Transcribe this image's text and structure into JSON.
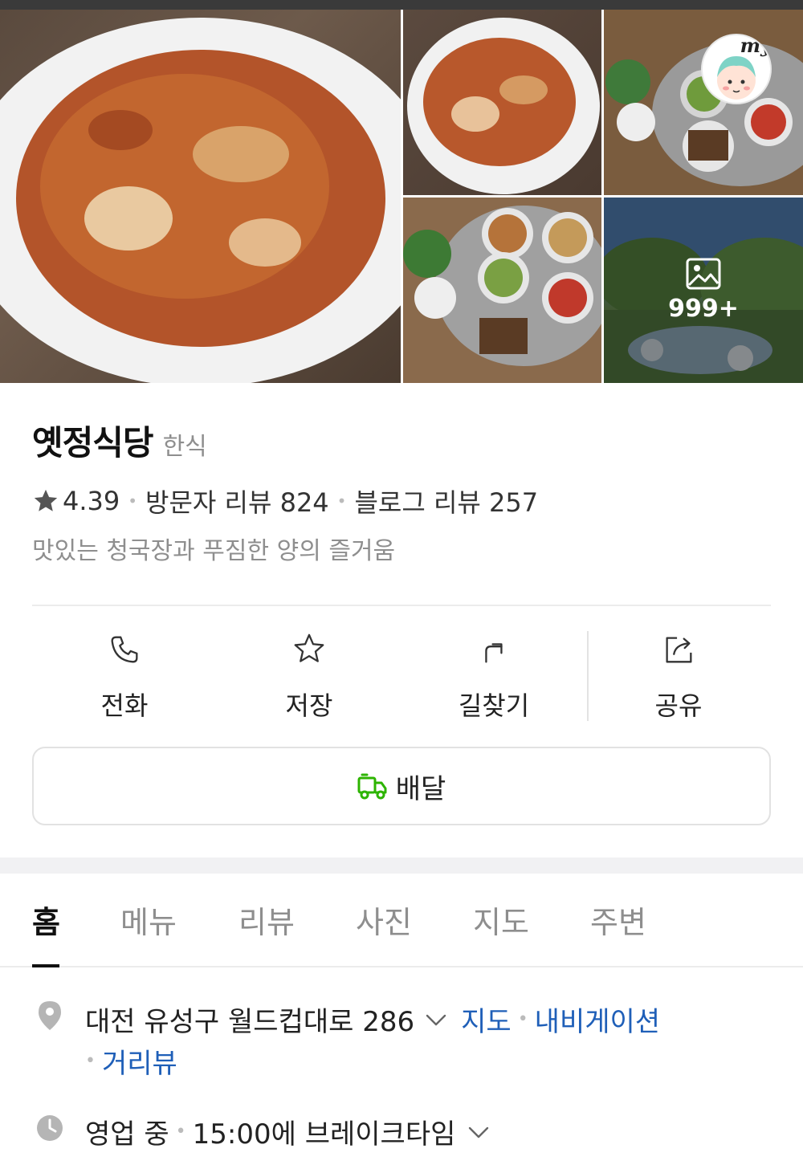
{
  "gallery": {
    "photo_count_overlay": "999+",
    "my_badge_label": "my"
  },
  "place": {
    "name": "옛정식당",
    "category": "한식",
    "rating": "4.39",
    "visitor_reviews": "방문자 리뷰 824",
    "blog_reviews": "블로그 리뷰 257",
    "description": "맛있는 청국장과 푸짐한 양의 즐거움"
  },
  "actions": [
    {
      "label": "전화",
      "icon": "phone-icon"
    },
    {
      "label": "저장",
      "icon": "star-outline-icon"
    },
    {
      "label": "길찾기",
      "icon": "directions-arrow-icon"
    },
    {
      "label": "공유",
      "icon": "share-icon"
    }
  ],
  "delivery": {
    "label": "배달",
    "icon": "delivery-truck-icon",
    "icon_color": "#2db400"
  },
  "tabs": [
    "홈",
    "메뉴",
    "리뷰",
    "사진",
    "지도",
    "주변"
  ],
  "active_tab": "홈",
  "address": {
    "text": "대전 유성구 월드컵대로 286",
    "link_map": "지도",
    "link_navigation": "내비게이션",
    "link_street_view": "거리뷰"
  },
  "hours": {
    "status": "영업 중",
    "detail": "15:00에 브레이크타임"
  },
  "colors": {
    "link": "#1f5fb8",
    "muted": "#8e8e8e"
  }
}
